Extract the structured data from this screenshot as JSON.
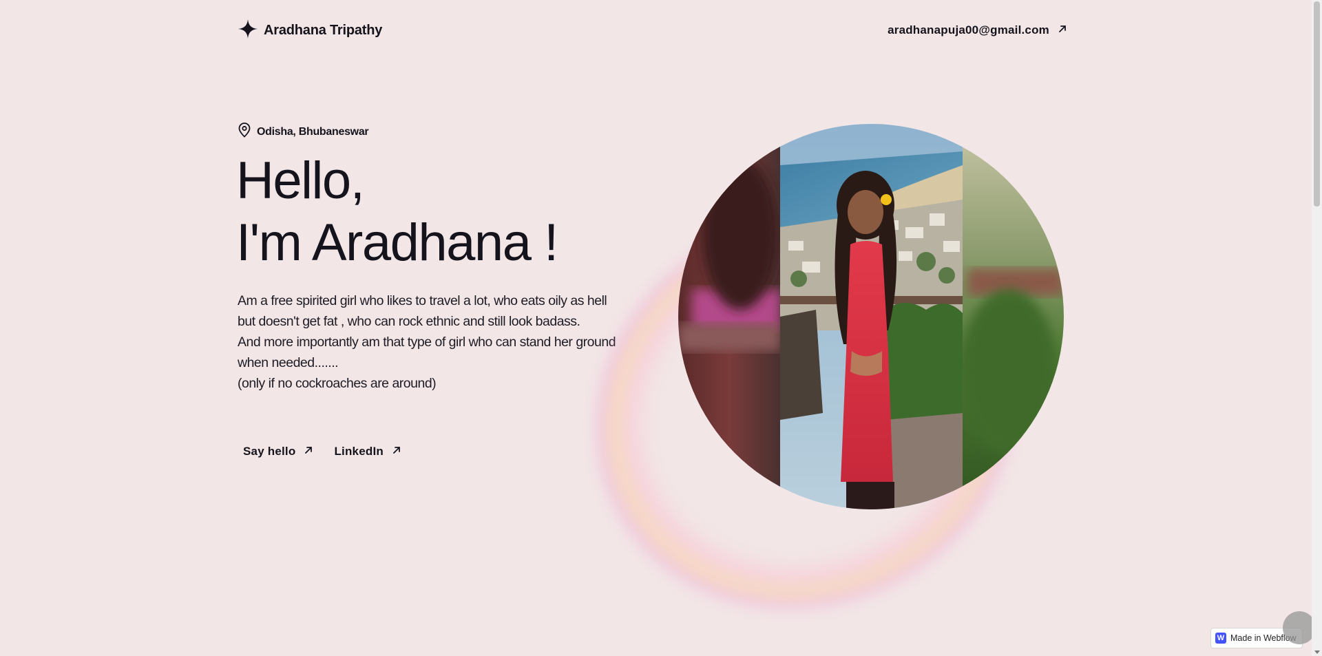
{
  "header": {
    "brand_name": "Aradhana Tripathy",
    "email": "aradhanapuja00@gmail.com"
  },
  "hero": {
    "location": "Odisha, Bhubaneswar",
    "headline_line1": "Hello,",
    "headline_line2": "I'm Aradhana !",
    "bio_lines": [
      "Am a free spirited girl who likes to travel a lot, who eats oily as hell",
      "but doesn't get fat , who can rock ethnic and still look badass.",
      "And more importantly am that type of girl who can stand her ground",
      "when needed.......",
      "(only if no cockroaches are around)"
    ],
    "cta_say_hello": "Say hello",
    "cta_linkedin": "LinkedIn"
  },
  "badge": {
    "label": "Made in Webflow",
    "logo_letter": "W"
  },
  "colors": {
    "background": "#f2e6e6",
    "text": "#15131c",
    "webflow_blue": "#4353ff"
  },
  "icons": {
    "brand": "sparkle-icon",
    "external": "arrow-up-right-icon",
    "location": "map-pin-icon"
  }
}
